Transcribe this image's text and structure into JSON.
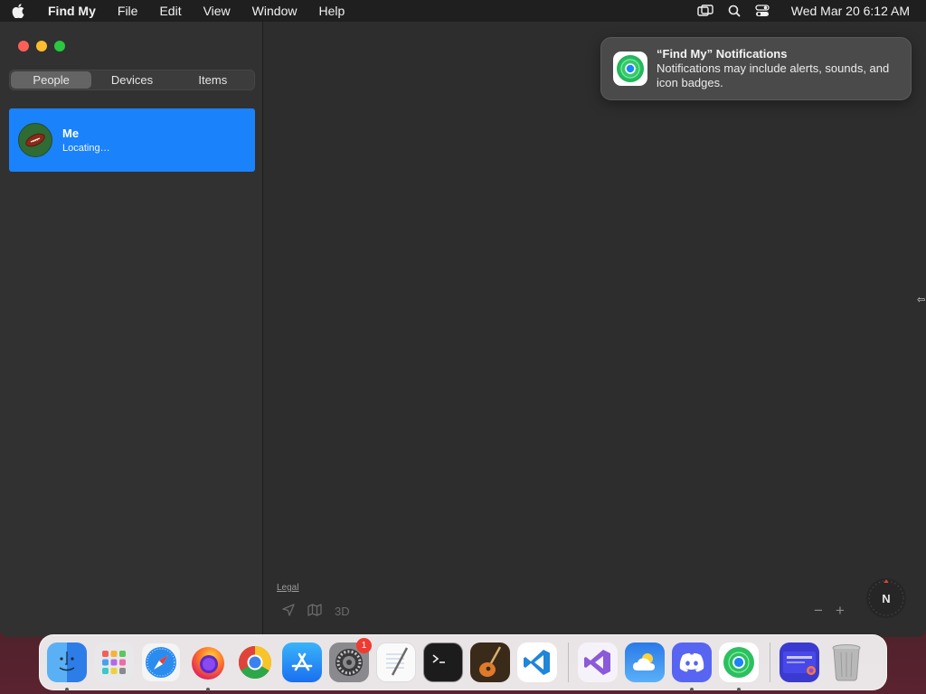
{
  "menubar": {
    "app_name": "Find My",
    "menus": [
      "File",
      "Edit",
      "View",
      "Window",
      "Help"
    ],
    "clock": "Wed Mar 20  6:12 AM",
    "status_icons": [
      "screen-mirroring-icon",
      "search-icon",
      "control-center-icon"
    ]
  },
  "sidebar": {
    "tabs": [
      {
        "label": "People",
        "active": true
      },
      {
        "label": "Devices",
        "active": false
      },
      {
        "label": "Items",
        "active": false
      }
    ],
    "people": [
      {
        "name": "Me",
        "status": "Locating…",
        "selected": true
      }
    ]
  },
  "map": {
    "legal_label": "Legal",
    "view_3d_label": "3D",
    "zoom_out_label": "−",
    "zoom_in_label": "+",
    "compass_label": "N"
  },
  "notification": {
    "title": "“Find My” Notifications",
    "body": "Notifications may include alerts, sounds, and icon badges."
  },
  "dock": {
    "items": [
      {
        "name": "finder",
        "running": true
      },
      {
        "name": "launchpad",
        "running": false
      },
      {
        "name": "safari",
        "running": false
      },
      {
        "name": "firefox",
        "running": true
      },
      {
        "name": "chrome",
        "running": false
      },
      {
        "name": "app-store",
        "running": false
      },
      {
        "name": "system-settings",
        "running": false,
        "badge": "1"
      },
      {
        "name": "textedit",
        "running": false
      },
      {
        "name": "terminal",
        "running": false
      },
      {
        "name": "garageband",
        "running": false
      },
      {
        "name": "vscode",
        "running": false
      },
      {
        "name": "visual-studio",
        "running": false
      },
      {
        "name": "weather",
        "running": false
      },
      {
        "name": "discord",
        "running": true
      },
      {
        "name": "find-my",
        "running": true
      },
      {
        "name": "firefox-window",
        "running": false
      },
      {
        "name": "trash",
        "running": false
      }
    ]
  },
  "colors": {
    "accent": "#1a82fb",
    "menubar": "#1f1f1f",
    "sidebar": "#313131",
    "map": "#2d2d2d"
  }
}
